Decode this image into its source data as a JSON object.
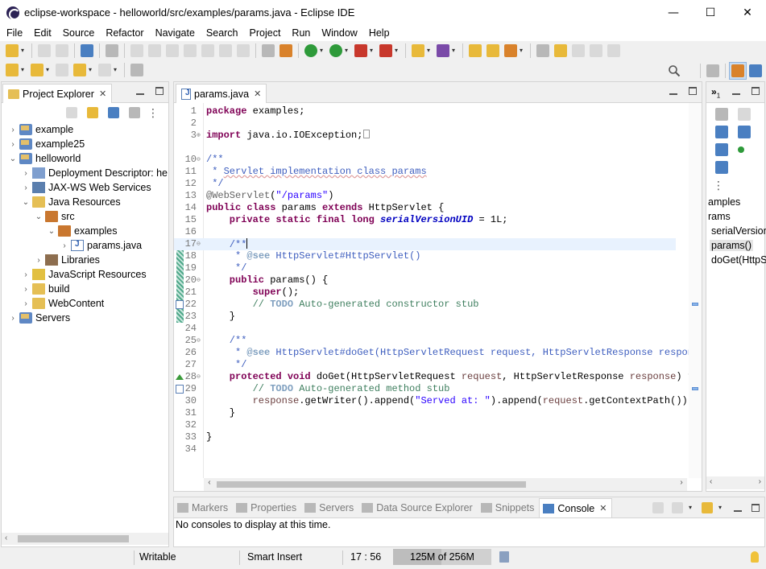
{
  "window": {
    "title": "eclipse-workspace - helloworld/src/examples/params.java - Eclipse IDE",
    "minimize": "—",
    "maximize": "☐",
    "close": "✕"
  },
  "menu": [
    "File",
    "Edit",
    "Source",
    "Refactor",
    "Navigate",
    "Search",
    "Project",
    "Run",
    "Window",
    "Help"
  ],
  "project_explorer": {
    "title": "Project Explorer",
    "items": [
      {
        "label": "example",
        "twisty": "›"
      },
      {
        "label": "example25",
        "twisty": "›"
      },
      {
        "label": "helloworld",
        "twisty": "⌄"
      },
      {
        "label": "Deployment Descriptor: he",
        "twisty": "›"
      },
      {
        "label": "JAX-WS Web Services",
        "twisty": "›"
      },
      {
        "label": "Java Resources",
        "twisty": "⌄"
      },
      {
        "label": "src",
        "twisty": "⌄"
      },
      {
        "label": "examples",
        "twisty": "⌄"
      },
      {
        "label": "params.java",
        "twisty": "›"
      },
      {
        "label": "Libraries",
        "twisty": "›"
      },
      {
        "label": "JavaScript Resources",
        "twisty": "›"
      },
      {
        "label": "build",
        "twisty": "›"
      },
      {
        "label": "WebContent",
        "twisty": "›"
      },
      {
        "label": "Servers",
        "twisty": "›"
      }
    ]
  },
  "editor": {
    "tab": "params.java",
    "line_numbers": [
      "1",
      "2",
      "3",
      "10",
      "11",
      "12",
      "13",
      "14",
      "15",
      "16",
      "17",
      "18",
      "19",
      "20",
      "21",
      "22",
      "23",
      "24",
      "25",
      "26",
      "27",
      "28",
      "29",
      "30",
      "31",
      "32",
      "33",
      "34"
    ],
    "code": {
      "l1_kw": "package",
      "l1_rest": " examples;",
      "l3_kw": "import",
      "l3_rest": " java.io.IOException;",
      "l10": "/**",
      "l11_a": " * ",
      "l11_b": "Servlet implementation class params",
      "l12": " */",
      "l13_a": "@WebServlet",
      "l13_b": "(",
      "l13_c": "\"/params\"",
      "l13_d": ")",
      "l14_kw1": "public",
      "l14_kw2": " class",
      "l14_a": " params ",
      "l14_kw3": "extends",
      "l14_b": " HttpServlet {",
      "l15_kw": "    private static final long ",
      "l15_fld": "serialVersionUID",
      "l15_rest": " = 1L;",
      "l17": "    /**",
      "l18_a": "     * ",
      "l18_tag": "@see",
      "l18_b": " HttpServlet#HttpServlet()",
      "l19": "     */",
      "l20_kw": "    public",
      "l20_rest": " params() {",
      "l21_kw": "        super",
      "l21_rest": "();",
      "l22_a": "        // ",
      "l22_todo": "TODO",
      "l22_b": " Auto-generated constructor stub",
      "l23": "    }",
      "l25": "    /**",
      "l26_a": "     * ",
      "l26_tag": "@see",
      "l26_b": " HttpServlet#doGet(HttpServletRequest request, HttpServletResponse respon",
      "l27": "     */",
      "l28_kw": "    protected void",
      "l28_a": " doGet(HttpServletRequest ",
      "l28_p1": "request",
      "l28_b": ", HttpServletResponse ",
      "l28_p2": "response",
      "l28_c": ") t",
      "l29_a": "        // ",
      "l29_todo": "TODO",
      "l29_b": " Auto-generated method stub",
      "l30_a": "        ",
      "l30_p1": "response",
      "l30_b": ".getWriter().append(",
      "l30_s": "\"Served at: \"",
      "l30_c": ").append(",
      "l30_p2": "request",
      "l30_d": ".getContextPath());",
      "l31": "    }",
      "l33": "}"
    }
  },
  "outline": {
    "items": [
      "amples",
      "rams",
      "serialVersion",
      "params()",
      "doGet(HttpS"
    ],
    "view_menu_label": "»",
    "view_count": "1"
  },
  "bottom_panel": {
    "tabs": [
      {
        "label": "Markers"
      },
      {
        "label": "Properties"
      },
      {
        "label": "Servers"
      },
      {
        "label": "Data Source Explorer"
      },
      {
        "label": "Snippets"
      },
      {
        "label": "Console"
      }
    ],
    "console_message": "No consoles to display at this time."
  },
  "status": {
    "writable": "Writable",
    "insert_mode": "Smart Insert",
    "position": "17 : 56",
    "heap": "125M of 256M",
    "heap_used_fraction": 0.488
  }
}
